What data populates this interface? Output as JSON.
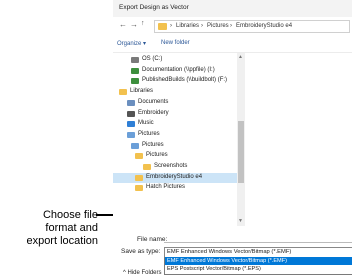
{
  "window_title": "Export Design as Vector",
  "nav": {
    "back": "←",
    "forward": "→",
    "up": "↑",
    "separator": "›"
  },
  "breadcrumb": [
    "Libraries",
    "Pictures",
    "EmbroideryStudio e4"
  ],
  "toolbar": {
    "organize": "Organize ▾",
    "new_folder": "New folder"
  },
  "tree": [
    {
      "label": "OS (C:)",
      "icon": "drive-icon",
      "color": "#7a7a7a"
    },
    {
      "label": "Documentation (\\\\ppfile) (I:)",
      "icon": "network-drive-icon",
      "color": "#3d8f3d"
    },
    {
      "label": "PublishedBuilds (\\\\buildbolt) (F:)",
      "icon": "network-drive-icon",
      "color": "#3d8f3d"
    },
    {
      "label": "Libraries",
      "icon": "libraries-icon",
      "color": "#f2c14e"
    },
    {
      "label": "Documents",
      "icon": "documents-icon",
      "color": "#6b8fbf"
    },
    {
      "label": "Embroidery",
      "icon": "folder-icon",
      "color": "#555555"
    },
    {
      "label": "Music",
      "icon": "music-icon",
      "color": "#2f7fd6"
    },
    {
      "label": "Pictures",
      "icon": "pictures-icon",
      "color": "#6b9fd8"
    },
    {
      "label": "Pictures",
      "icon": "pictures-icon",
      "color": "#6b9fd8"
    },
    {
      "label": "Pictures",
      "icon": "folder-icon",
      "color": "#f2c14e"
    },
    {
      "label": "Screenshots",
      "icon": "folder-icon",
      "color": "#f2c14e"
    },
    {
      "label": "EmbroideryStudio e4",
      "icon": "folder-icon",
      "color": "#f2c14e",
      "selected": true
    },
    {
      "label": "Hatch Pictures",
      "icon": "folder-icon",
      "color": "#f2c14e"
    }
  ],
  "form": {
    "file_name_label": "File name:",
    "save_as_type_label": "Save as type:",
    "save_as_type_value": "EMF Enhanced Windows Vector/Bitmap (*.EMF)",
    "options": [
      {
        "label": "EMF Enhanced Windows Vector/Bitmap (*.EMF)",
        "selected": true
      },
      {
        "label": "EPS Postscript Vector/Bitmap (*.EPS)",
        "selected": false
      }
    ]
  },
  "hide_folders": "^ Hide Folders",
  "callout": {
    "line1": "Choose file",
    "line2": "format and",
    "line3": "export location"
  }
}
